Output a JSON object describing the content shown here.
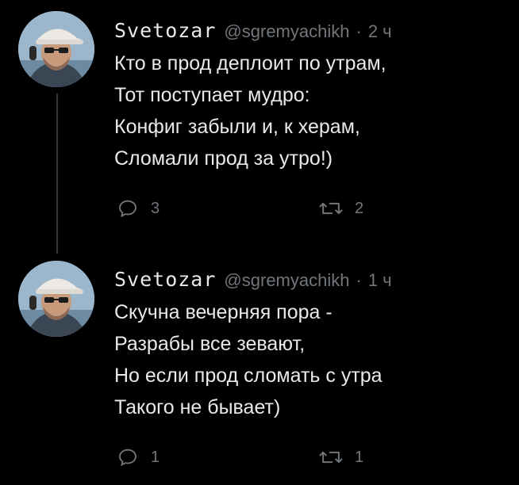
{
  "tweets": [
    {
      "author": {
        "display_name": "Svetozar",
        "handle": "@sgremyachikh"
      },
      "separator": "·",
      "time": "2 ч",
      "lines": [
        "Кто в прод деплоит по утрам,",
        "Тот поступает мудро:",
        "Конфиг забыли и, к херам,",
        "Сломали прод за утро!)"
      ],
      "reply_count": "3",
      "retweet_count": "2"
    },
    {
      "author": {
        "display_name": "Svetozar",
        "handle": "@sgremyachikh"
      },
      "separator": "·",
      "time": "1 ч",
      "lines": [
        "Скучна вечерняя пора -",
        "Разрабы все зевают,",
        "Но если прод сломать с утра",
        "Такого не бывает)"
      ],
      "reply_count": "1",
      "retweet_count": "1"
    }
  ],
  "icons": {
    "reply": "reply-icon",
    "retweet": "retweet-icon"
  },
  "colors": {
    "background": "#000000",
    "text": "#e7e9ea",
    "secondary": "#71767b",
    "thread_line": "#333639"
  }
}
